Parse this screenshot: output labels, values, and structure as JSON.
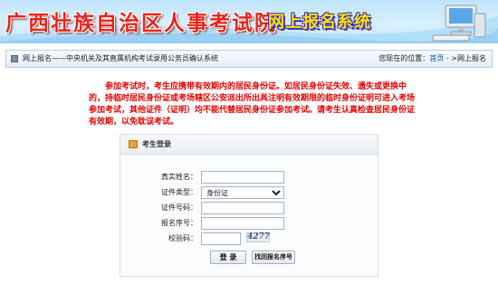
{
  "header": {
    "title": "广西壮族自治区人事考试院",
    "system": "网上报名系统"
  },
  "breadcrumb": {
    "text": "网上报名——中央机关及其直属机构考试录用公务员确认系统",
    "location_prefix": "您现在的位置：",
    "home_link": "首页",
    "location_suffix": " - >网上报名"
  },
  "notice": {
    "text": "参加考试时，考生应携带有效期内的居民身份证。如居民身份证失效、遗失或更换中的，持临时居民身份证或考场辖区公安派出所出具注明有效期限的临时身份证明可进入考场参加考试，其他证件（证明）均不能代替居民身份证参加考试。请考生认真检查居民身份证有效期，以免耽误考试。"
  },
  "login": {
    "title": "考生登录",
    "name_label": "真实姓名：",
    "name_value": "",
    "id_type_label": "证件类型：",
    "id_type_selected": "身份证",
    "id_number_label": "证件号码：",
    "id_number_value": "",
    "reg_number_label": "报名序号：",
    "reg_number_value": "",
    "captcha_label": "校验码：",
    "captcha_value": "",
    "captcha_text": "4277",
    "login_button": "登 录",
    "find_button": "找回报名序号"
  },
  "colors": {
    "notice": "#e60000",
    "title": "#e8241b",
    "system": "#ffe400",
    "link": "#1a4fb0"
  }
}
